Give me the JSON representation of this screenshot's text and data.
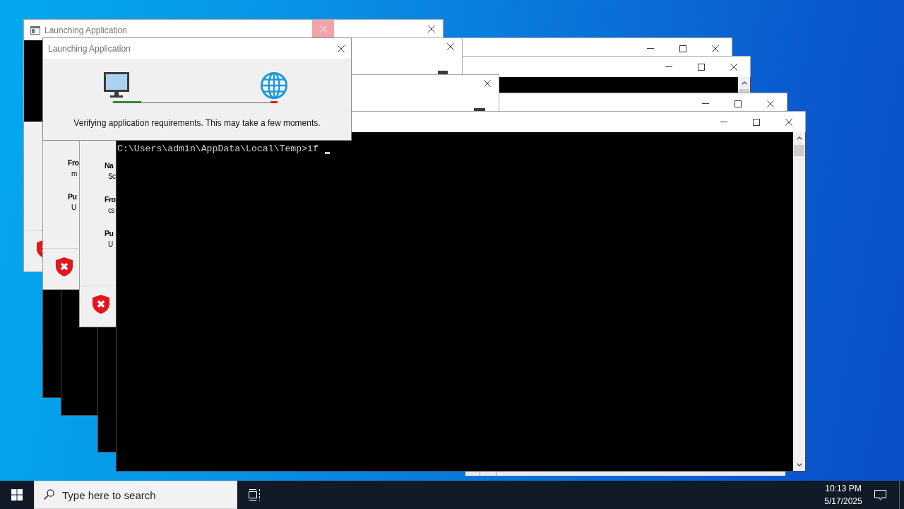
{
  "windows": [
    {
      "kind": "launcher",
      "title": "Launching Application",
      "close_hovered": true
    },
    {
      "kind": "launcher",
      "title": "Launching Application",
      "close_hovered": false,
      "message": "Verifying application requirements. This may take a few moments.",
      "progress": {
        "level": 0.17
      }
    },
    {
      "kind": "console",
      "lines": [
        "C:\\Users\\admin\\AppData\\Local\\Temp>if"
      ],
      "cursor": true
    },
    {
      "kind": "security_warning",
      "fields": [
        {
          "label": "Fro",
          "value": "m"
        },
        {
          "label": "Pu",
          "value": "U"
        }
      ]
    },
    {
      "kind": "security_warning",
      "fields": [
        {
          "label": "Na",
          "value": "Sc"
        },
        {
          "label": "Fro",
          "value": "cs"
        },
        {
          "label": "Pu",
          "value": "U"
        }
      ]
    },
    {
      "kind": "security_warning"
    },
    {
      "kind": "console"
    },
    {
      "kind": "console"
    },
    {
      "kind": "console"
    },
    {
      "kind": "covered"
    }
  ],
  "taskbar": {
    "search": {
      "placeholder": "Type here to search"
    },
    "clock": {
      "time": "10:13 PM",
      "date": "5/17/2025"
    }
  }
}
